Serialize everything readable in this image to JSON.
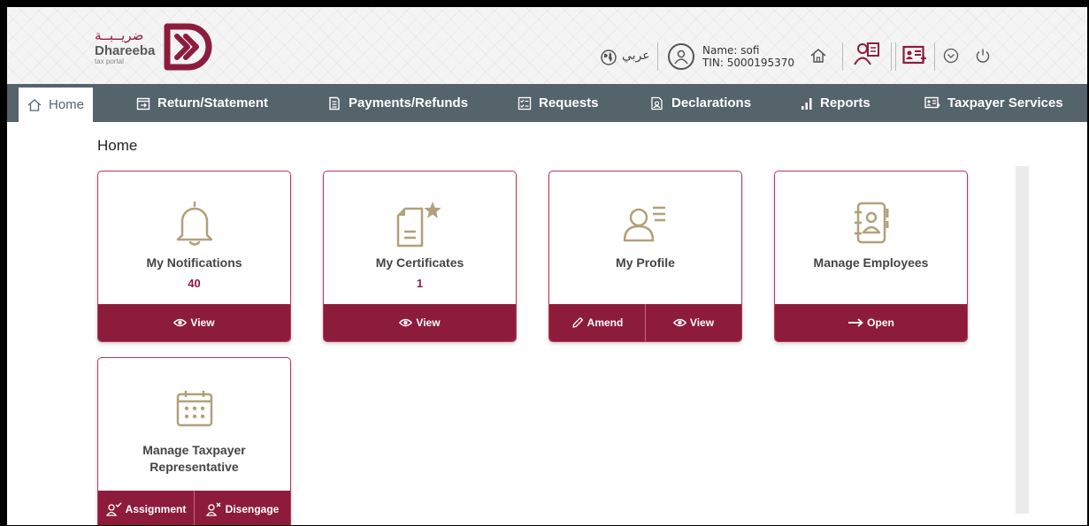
{
  "header": {
    "logo_arabic": "ضريــبــة",
    "logo_name": "Dhareeba",
    "logo_sub": "tax portal",
    "language_label": "عربي",
    "user_name": "Name: sofi",
    "user_tin": "TIN: 5000195370"
  },
  "nav": {
    "home": "Home",
    "return_statement": "Return/Statement",
    "payments_refunds": "Payments/Refunds",
    "requests": "Requests",
    "declarations": "Declarations",
    "reports": "Reports",
    "taxpayer_services": "Taxpayer Services"
  },
  "page": {
    "title": "Home"
  },
  "cards": {
    "notifications": {
      "title": "My Notifications",
      "count": "40",
      "view": "View"
    },
    "certificates": {
      "title": "My Certificates",
      "count": "1",
      "view": "View"
    },
    "profile": {
      "title": "My Profile",
      "amend": "Amend",
      "view": "View"
    },
    "employees": {
      "title": "Manage Employees",
      "open": "Open"
    },
    "representative": {
      "title_line1": "Manage Taxpayer",
      "title_line2": "Representative",
      "assignment": "Assignment",
      "disengage": "Disengage"
    }
  },
  "colors": {
    "brand": "#8d1c3c",
    "nav": "#55636b",
    "icon_gold": "#b1a07a"
  },
  "icons": [
    "globe-icon",
    "user-circle-icon",
    "home-icon",
    "questionnaire-icon",
    "id-card-icon",
    "chevron-down-icon",
    "power-icon",
    "bell-icon",
    "certificate-icon",
    "profile-icon",
    "contacts-book-icon",
    "calendar-icon",
    "eye-icon",
    "pencil-icon",
    "arrow-right-icon",
    "user-check-icon",
    "user-x-icon"
  ]
}
